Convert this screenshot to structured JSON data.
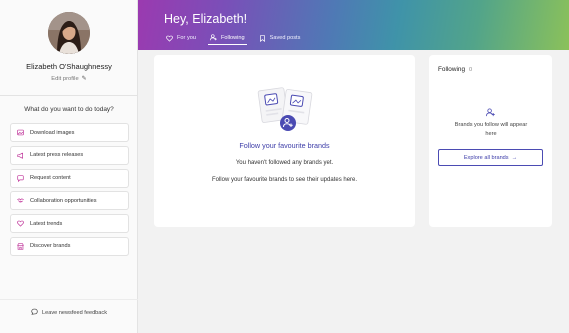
{
  "profile": {
    "name": "Elizabeth O'Shaughnessy",
    "edit_label": "Edit profile"
  },
  "sidebar": {
    "heading": "What do you want to do today?",
    "actions": [
      {
        "label": "Download images",
        "icon": "image-icon"
      },
      {
        "label": "Latest press releases",
        "icon": "megaphone-icon"
      },
      {
        "label": "Request content",
        "icon": "chat-icon"
      },
      {
        "label": "Collaboration opportunities",
        "icon": "handshake-icon"
      },
      {
        "label": "Latest trends",
        "icon": "heart-icon"
      },
      {
        "label": "Discover brands",
        "icon": "store-icon"
      }
    ],
    "feedback_label": "Leave newsfeed feedback"
  },
  "hero": {
    "greeting": "Hey, Elizabeth!",
    "tabs": [
      {
        "label": "For you",
        "icon": "heart-icon",
        "active": false
      },
      {
        "label": "Following",
        "icon": "user-plus-icon",
        "active": true
      },
      {
        "label": "Saved posts",
        "icon": "bookmark-icon",
        "active": false
      }
    ]
  },
  "main": {
    "title": "Follow your favourite brands",
    "line1": "You haven't followed any brands yet.",
    "line2": "Follow your favourite brands to see their updates here."
  },
  "following": {
    "title": "Following",
    "count": "0",
    "empty_text": "Brands you follow will appear here",
    "explore_label": "Explore all brands",
    "arrow": "→"
  },
  "colors": {
    "accent": "#3e3ea8",
    "icon_pink": "#c0359a",
    "hero_start": "#9b3ab0",
    "hero_end": "#8bc15a"
  }
}
